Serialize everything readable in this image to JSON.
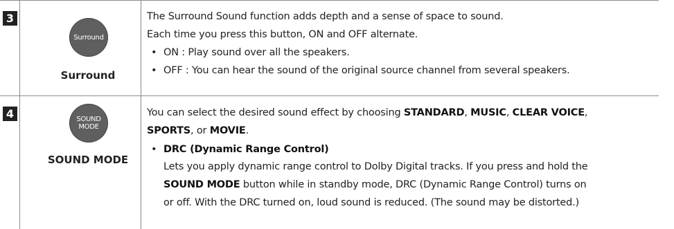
{
  "rows": [
    {
      "number": "3",
      "button_text": "Surround",
      "label": "Surround",
      "lines": [
        "The Surround Sound function adds depth and a sense of space to sound.",
        "Each time you press this button, ON and OFF alternate."
      ],
      "bullets": [
        "ON : Play sound over all the speakers.",
        "OFF : You can hear the sound of the original source channel from several speakers."
      ]
    },
    {
      "number": "4",
      "button_text_line1": "SOUND",
      "button_text_line2": "MODE",
      "label": "SOUND MODE",
      "intro_prefix": "You can select the desired sound effect by choosing ",
      "modes": [
        "STANDARD",
        "MUSIC",
        "CLEAR VOICE",
        "SPORTS",
        "MOVIE"
      ],
      "sep": ", ",
      "or_text": ", or ",
      "period": ".",
      "drc_title": "DRC (Dynamic Range Control)",
      "drc_line1": "Lets you apply dynamic range control to Dolby Digital tracks. If you press and hold the",
      "drc_line2_bold": "SOUND MODE",
      "drc_line2_rest": " button while in standby mode, DRC (Dynamic Range Control) turns on",
      "drc_line3": "or off. With the DRC turned on, loud sound is reduced. (The sound may be distorted.)"
    }
  ]
}
